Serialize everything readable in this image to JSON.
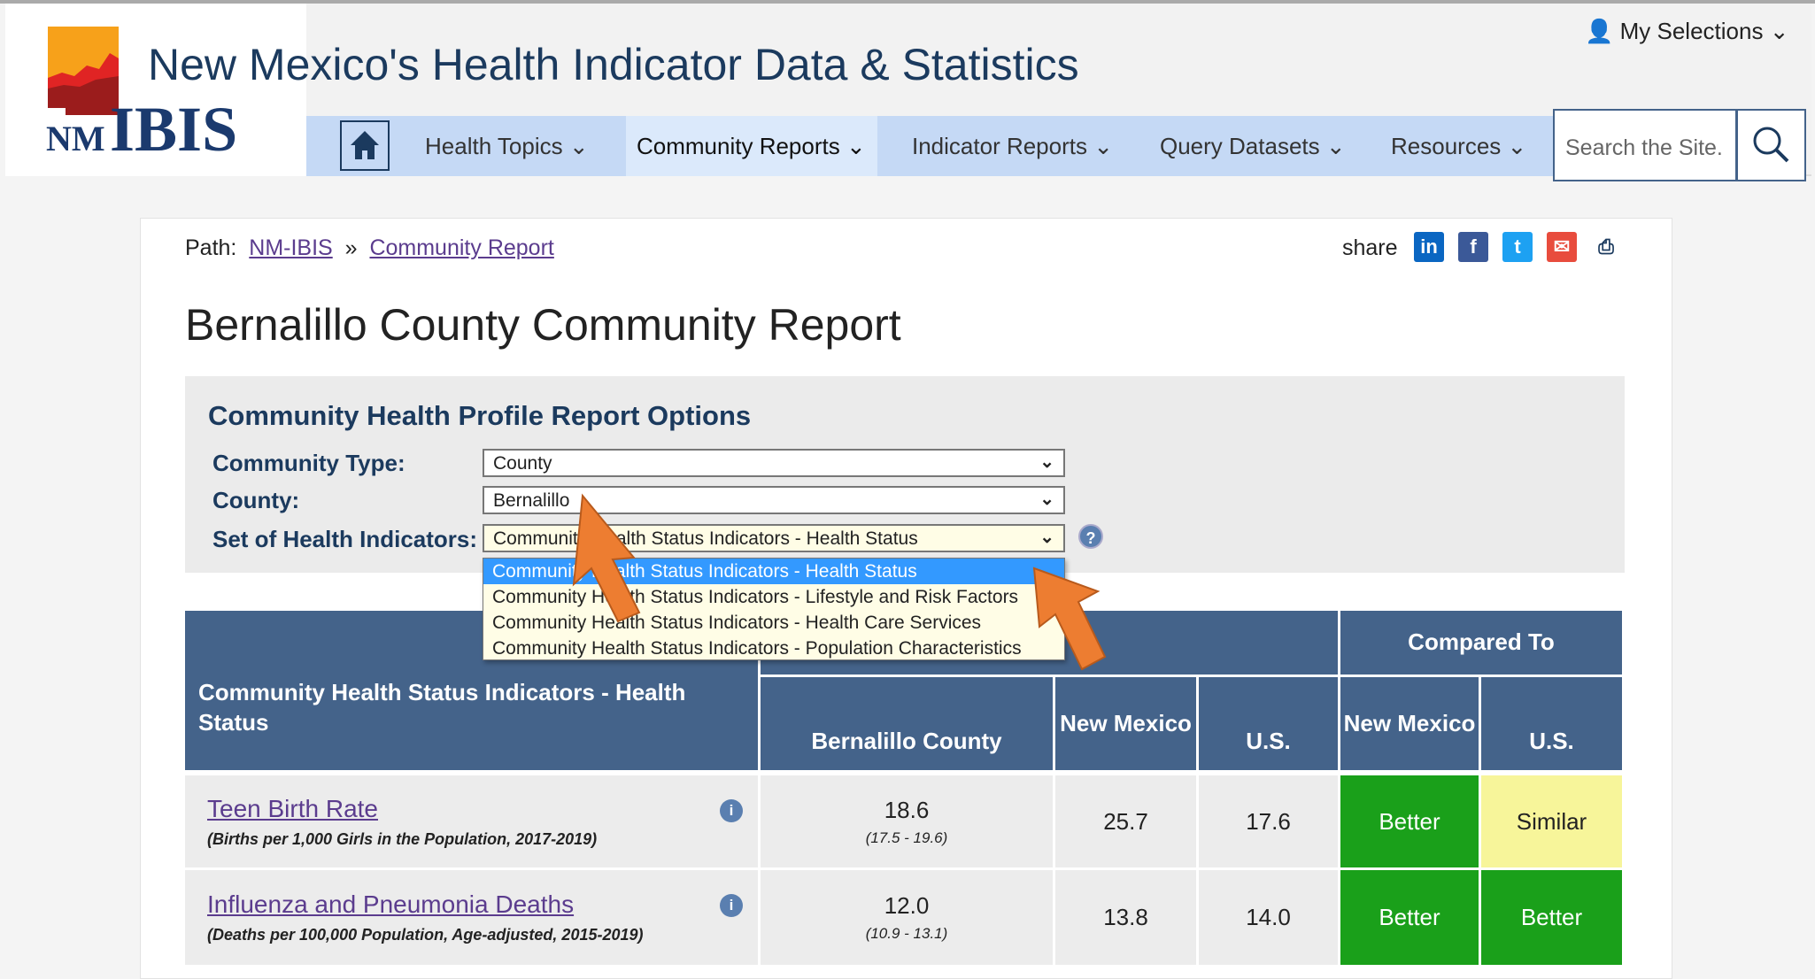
{
  "header": {
    "title": "New Mexico's Health Indicator Data & Statistics",
    "logo_text": "NMIBIS",
    "my_selections": "My Selections"
  },
  "nav": {
    "items": [
      "Health Topics",
      "Community Reports",
      "Indicator Reports",
      "Query Datasets",
      "Resources"
    ],
    "active": "Community Reports",
    "search_placeholder": "Search the Site."
  },
  "breadcrumb": {
    "label": "Path:",
    "items": [
      "NM-IBIS",
      "Community Report"
    ],
    "separator": "»"
  },
  "share": {
    "label": "share",
    "icons": [
      "linkedin-icon",
      "facebook-icon",
      "twitter-icon",
      "email-icon",
      "print-icon"
    ]
  },
  "page_title": "Bernalillo County Community Report",
  "options": {
    "title": "Community Health Profile Report Options",
    "community_type_label": "Community Type:",
    "community_type": "County",
    "county_label": "County:",
    "county": "Bernalillo",
    "set_label": "Set of Health Indicators:",
    "set": "Community Health Status Indicators - Health Status",
    "set_options": [
      "Community Health Status Indicators - Health Status",
      "Community Health Status Indicators - Lifestyle and Risk Factors",
      "Community Health Status Indicators - Health Care Services",
      "Community Health Status Indicators - Population Characteristics"
    ]
  },
  "table": {
    "compared_to": "Compared To",
    "col_indicator": "Community Health Status Indicators - Health Status",
    "col_county": "Bernalillo  County",
    "col_nm": "New Mexico",
    "col_us": "U.S.",
    "col_cmp_nm": "New Mexico",
    "col_cmp_us": "U.S.",
    "rows": [
      {
        "name": "Teen Birth Rate",
        "sub": "(Births per 1,000 Girls in the Population, 2017-2019)",
        "county": "18.6",
        "ci": "(17.5 - 19.6)",
        "nm": "25.7",
        "us": "17.6",
        "cmp_nm": "Better",
        "cmp_us": "Similar"
      },
      {
        "name": "Influenza and Pneumonia Deaths",
        "sub": "(Deaths per 100,000 Population, Age-adjusted, 2015-2019)",
        "county": "12.0",
        "ci": "(10.9 - 13.1)",
        "nm": "13.8",
        "us": "14.0",
        "cmp_nm": "Better",
        "cmp_us": "Better"
      }
    ]
  },
  "colors": {
    "nav": "#c5d9f5",
    "table_header": "#44638a",
    "better": "#1aa01a",
    "similar": "#f7f59a",
    "arrow": "#ed7d31"
  }
}
